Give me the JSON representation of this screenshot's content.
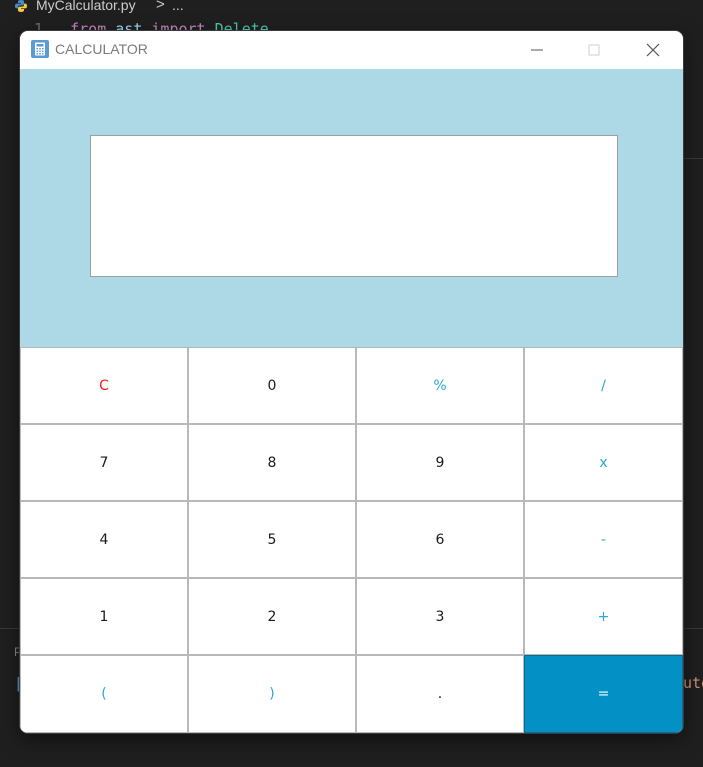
{
  "editor": {
    "breadcrumb_file": "MyCalculator.py",
    "breadcrumb_sep": ">",
    "breadcrumb_more": "...",
    "line_number": "1",
    "code_kw": "from",
    "code_mod": "ast",
    "code_import": "import",
    "code_cls": "Delete",
    "panel_letter": "P",
    "panel_bracket": "[",
    "panel_tail": "ute"
  },
  "window": {
    "title": "CALCULATOR",
    "minimize_label": "—",
    "maximize_label": "☐",
    "close_label": "✕"
  },
  "display": {
    "value": ""
  },
  "keypad": {
    "rows": [
      [
        {
          "label": "C",
          "style": "red",
          "name": "clear-button"
        },
        {
          "label": "0",
          "style": "",
          "name": "digit-0-button"
        },
        {
          "label": "%",
          "style": "blue",
          "name": "percent-button"
        },
        {
          "label": "/",
          "style": "blue",
          "name": "divide-button"
        }
      ],
      [
        {
          "label": "7",
          "style": "",
          "name": "digit-7-button"
        },
        {
          "label": "8",
          "style": "",
          "name": "digit-8-button"
        },
        {
          "label": "9",
          "style": "",
          "name": "digit-9-button"
        },
        {
          "label": "x",
          "style": "blue",
          "name": "multiply-button"
        }
      ],
      [
        {
          "label": "4",
          "style": "",
          "name": "digit-4-button"
        },
        {
          "label": "5",
          "style": "",
          "name": "digit-5-button"
        },
        {
          "label": "6",
          "style": "",
          "name": "digit-6-button"
        },
        {
          "label": "-",
          "style": "blue",
          "name": "subtract-button"
        }
      ],
      [
        {
          "label": "1",
          "style": "",
          "name": "digit-1-button"
        },
        {
          "label": "2",
          "style": "",
          "name": "digit-2-button"
        },
        {
          "label": "3",
          "style": "",
          "name": "digit-3-button"
        },
        {
          "label": "+",
          "style": "blue",
          "name": "add-button"
        }
      ],
      [
        {
          "label": "(",
          "style": "blue",
          "name": "open-paren-button"
        },
        {
          "label": ")",
          "style": "blue",
          "name": "close-paren-button"
        },
        {
          "label": ".",
          "style": "",
          "name": "decimal-button"
        },
        {
          "label": "=",
          "style": "equals",
          "name": "equals-button"
        }
      ]
    ]
  },
  "colors": {
    "display_bg": "#add8e6",
    "equals_bg": "#0390c4",
    "accent_blue": "#2aa7d6",
    "clear_red": "#ff1a1a"
  }
}
